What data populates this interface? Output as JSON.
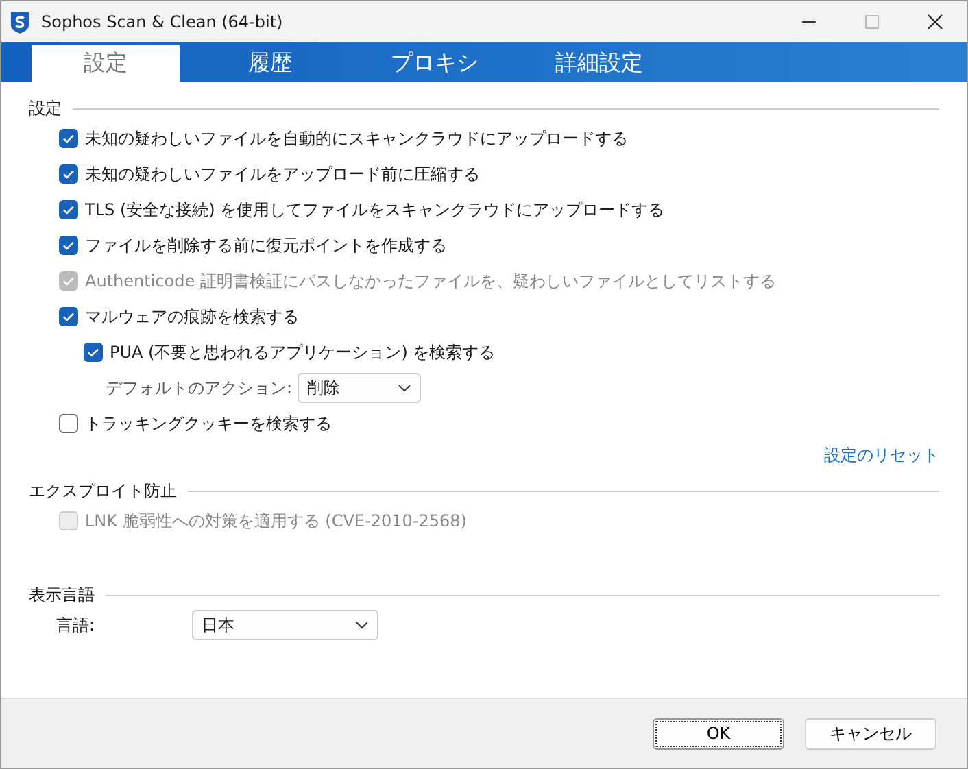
{
  "window": {
    "title": "Sophos Scan & Clean (64-bit)"
  },
  "tabs": [
    {
      "label": "設定",
      "selected": true
    },
    {
      "label": "履歴",
      "selected": false
    },
    {
      "label": "プロキシ",
      "selected": false
    },
    {
      "label": "詳細設定",
      "selected": false
    }
  ],
  "sections": [
    {
      "title": "設定",
      "items": [
        {
          "kind": "checkbox",
          "label": "未知の疑わしいファイルを自動的にスキャンクラウドにアップロードする",
          "checked": true,
          "disabled": false
        },
        {
          "kind": "checkbox",
          "label": "未知の疑わしいファイルをアップロード前に圧縮する",
          "checked": true,
          "disabled": false
        },
        {
          "kind": "checkbox",
          "label": "TLS (安全な接続) を使用してファイルをスキャンクラウドにアップロードする",
          "checked": true,
          "disabled": false
        },
        {
          "kind": "checkbox",
          "label": "ファイルを削除する前に復元ポイントを作成する",
          "checked": true,
          "disabled": false
        },
        {
          "kind": "checkbox",
          "label": "Authenticode 証明書検証にパスしなかったファイルを、疑わしいファイルとしてリストする",
          "checked": true,
          "disabled": true
        },
        {
          "kind": "checkbox",
          "label": "マルウェアの痕跡を検索する",
          "checked": true,
          "disabled": false,
          "children": [
            {
              "kind": "checkbox",
              "label": "PUA (不要と思われるアプリケーション) を検索する",
              "checked": true,
              "disabled": false,
              "children": [
                {
                  "kind": "dropdown",
                  "label": "デフォルトのアクション:",
                  "value": "削除"
                }
              ]
            }
          ]
        },
        {
          "kind": "checkbox",
          "label": "トラッキングクッキーを検索する",
          "checked": false,
          "disabled": false
        }
      ],
      "link": "設定のリセット"
    },
    {
      "title": "エクスプロイト防止",
      "items": [
        {
          "kind": "checkbox",
          "label": "LNK 脆弱性への対策を適用する (CVE-2010-2568)",
          "checked": false,
          "disabled": true
        }
      ]
    },
    {
      "title": "表示言語",
      "items": [
        {
          "kind": "language",
          "label": "言語:",
          "value": "日本"
        }
      ]
    }
  ],
  "buttons": [
    {
      "label": "OK",
      "default": true
    },
    {
      "label": "キャンセル",
      "default": false
    }
  ]
}
